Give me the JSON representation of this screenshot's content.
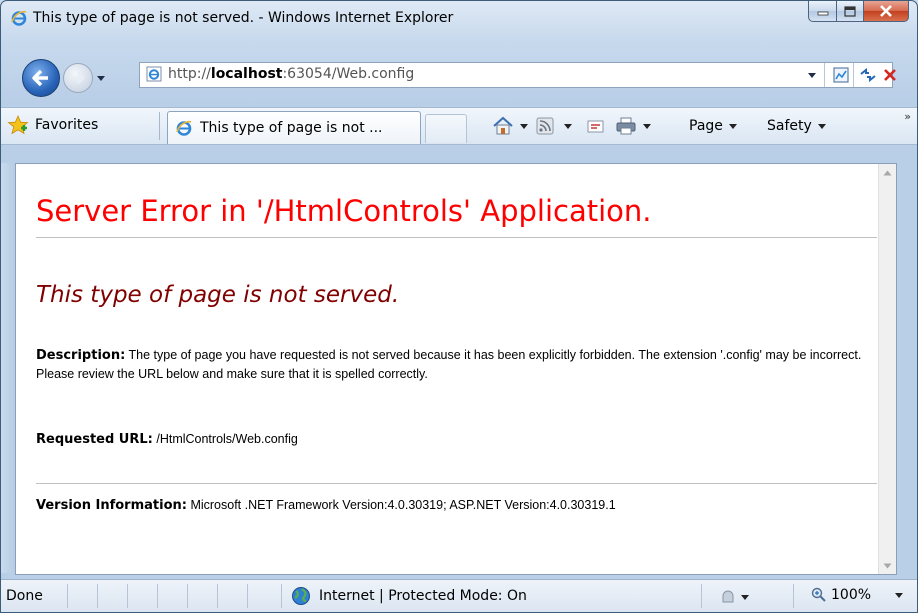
{
  "window": {
    "title": "This type of page is not served. - Windows Internet Explorer"
  },
  "address_bar": {
    "url_prefix": "http://",
    "url_host": "localhost",
    "url_rest": ":63054/Web.config"
  },
  "command_bar": {
    "favorites_label": "Favorites",
    "tab_label": "This type of page is not ...",
    "page_label": "Page",
    "safety_label": "Safety",
    "overflow_label": "»"
  },
  "page": {
    "heading": "Server Error in '/HtmlControls' Application.",
    "subheading": "This type of page is not served.",
    "description_label": "Description:",
    "description_text": "The type of page you have requested is not served because it has been explicitly forbidden.  The extension '.config' may be incorrect.   Please review the URL below and make sure that it is spelled correctly.",
    "requested_url_label": "Requested URL:",
    "requested_url_value": "/HtmlControls/Web.config",
    "version_label": "Version Information:",
    "version_value": "Microsoft .NET Framework Version:4.0.30319; ASP.NET Version:4.0.30319.1"
  },
  "status_bar": {
    "status_text": "Done",
    "zone_text": "Internet | Protected Mode: On",
    "zoom_text": "100%"
  },
  "colors": {
    "heading": "#ff0000",
    "subheading": "#800000",
    "link_blue": "#1e5fb4"
  },
  "icons": [
    "ie-logo-icon",
    "back-arrow-icon",
    "forward-arrow-icon",
    "compatibility-view-icon",
    "refresh-icon",
    "stop-icon",
    "favorites-star-icon",
    "home-icon",
    "feeds-icon",
    "read-mail-icon",
    "print-icon",
    "globe-icon",
    "add-on-icon",
    "zoom-icon"
  ]
}
